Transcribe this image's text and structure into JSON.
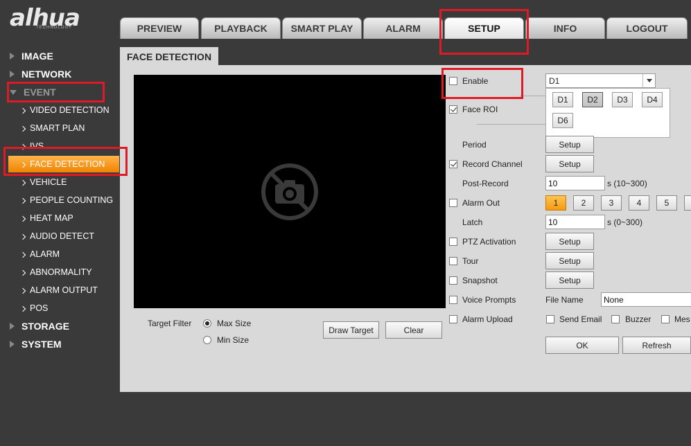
{
  "brand": {
    "logo_text": "alhua",
    "logo_sub": "TECHNOLOGY"
  },
  "tabs": [
    {
      "label": "PREVIEW"
    },
    {
      "label": "PLAYBACK"
    },
    {
      "label": "SMART PLAY"
    },
    {
      "label": "ALARM"
    },
    {
      "label": "SETUP",
      "active": true
    },
    {
      "label": "INFO"
    },
    {
      "label": "LOGOUT"
    }
  ],
  "nav": {
    "image": "IMAGE",
    "network": "NETWORK",
    "event": "EVENT",
    "sub": {
      "video_detection": "VIDEO DETECTION",
      "smart_plan": "SMART PLAN",
      "ivs": "IVS",
      "face_detection": "FACE DETECTION",
      "vehicle": "VEHICLE",
      "people_counting": "PEOPLE COUNTING",
      "heat_map": "HEAT MAP",
      "audio_detect": "AUDIO DETECT",
      "alarm": "ALARM",
      "abnormality": "ABNORMALITY",
      "alarm_output": "ALARM OUTPUT",
      "pos": "POS"
    },
    "storage": "STORAGE",
    "system": "SYSTEM"
  },
  "page": {
    "title": "FACE DETECTION",
    "target_filter": "Target Filter",
    "max_size": "Max Size",
    "min_size": "Min Size",
    "draw_target": "Draw Target",
    "clear": "Clear"
  },
  "settings": {
    "enable": "Enable",
    "channel_value": "D1",
    "channel_options": [
      "D1",
      "D2",
      "D3",
      "D4",
      "D6"
    ],
    "channel_highlighted": "D2",
    "face_roi": "Face ROI",
    "period": "Period",
    "record_channel": "Record Channel",
    "post_record": "Post-Record",
    "post_record_value": "10",
    "post_record_range": "s (10~300)",
    "alarm_out": "Alarm Out",
    "alarm_out_channels": [
      "1",
      "2",
      "3",
      "4",
      "5"
    ],
    "latch": "Latch",
    "latch_value": "10",
    "latch_range": "s (0~300)",
    "ptz_activation": "PTZ Activation",
    "tour": "Tour",
    "snapshot": "Snapshot",
    "voice_prompts": "Voice Prompts",
    "file_name": "File Name",
    "file_name_value": "None",
    "alarm_upload": "Alarm Upload",
    "send_email": "Send Email",
    "buzzer": "Buzzer",
    "message": "Mes",
    "setup_label": "Setup",
    "ok": "OK",
    "refresh": "Refresh"
  },
  "colors": {
    "accent_orange": "#f39a10",
    "highlight_red": "#e01a24",
    "panel_bg": "#d9d9d9",
    "app_bg": "#3a3a3a"
  }
}
